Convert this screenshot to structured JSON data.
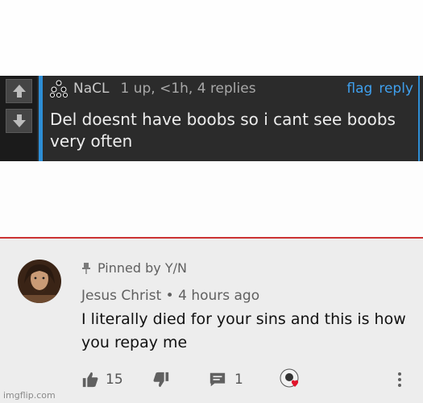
{
  "reddit_comment": {
    "username": "NaCL",
    "meta": "1 up, <1h, 4 replies",
    "flag_label": "flag",
    "reply_label": "reply",
    "body": "Del doesnt have boobs so i cant see boobs very often"
  },
  "youtube_comment": {
    "pinned_text": "Pinned by Y/N",
    "author": "Jesus Christ",
    "separator": "•",
    "time": "4 hours ago",
    "text": "I literally died for your sins and this is how you repay me",
    "like_count": "15",
    "reply_count": "1"
  },
  "watermark": "imgflip.com",
  "colors": {
    "dark_bg": "#2b2b2b",
    "accent_blue": "#2d8ed6",
    "divider_red": "#cc3333",
    "panel_bg": "#ededed",
    "heart": "#e0142b"
  },
  "icons": [
    "upvote-arrow-icon",
    "downvote-arrow-icon",
    "pin-icon",
    "thumbs-up-icon",
    "thumbs-down-icon",
    "comment-icon",
    "heart-icon",
    "more-vert-icon"
  ]
}
